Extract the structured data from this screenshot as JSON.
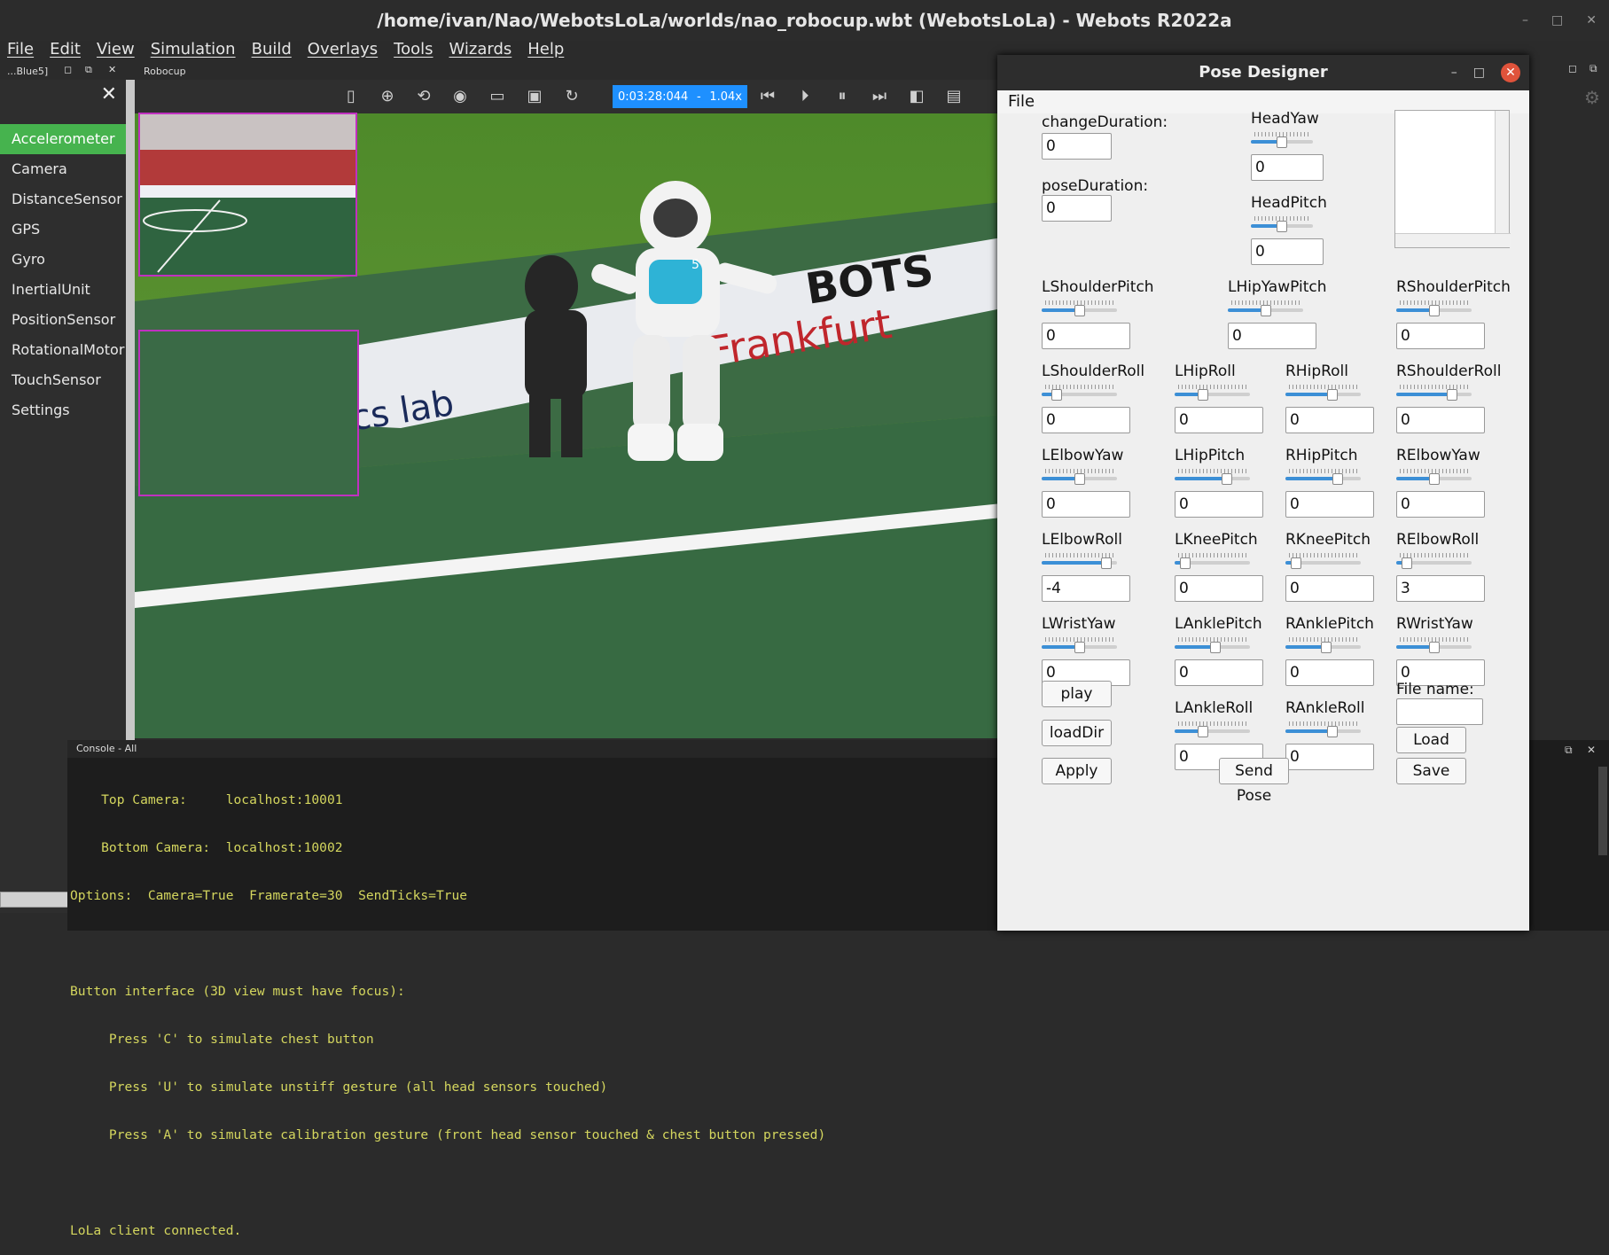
{
  "window": {
    "title": "/home/ivan/Nao/WebotsLoLa/worlds/nao_robocup.wbt (WebotsLoLa) - Webots R2022a",
    "controls": [
      "–",
      "□",
      "✕"
    ]
  },
  "menu": [
    "File",
    "Edit",
    "View",
    "Simulation",
    "Build",
    "Overlays",
    "Tools",
    "Wizards",
    "Help"
  ],
  "subtabs": {
    "left": "...Blue5]",
    "right": "Robocup"
  },
  "sidebar": {
    "items": [
      "Accelerometer",
      "Camera",
      "DistanceSensor",
      "GPS",
      "Gyro",
      "InertialUnit",
      "PositionSensor",
      "RotationalMotor",
      "TouchSensor",
      "Settings"
    ],
    "active": "Accelerometer"
  },
  "toolbar": {
    "time": "0:03:28:044",
    "separator": "-",
    "speed": "1.04x"
  },
  "scene": {
    "banner_text_1": "BOTS",
    "banner_text_2": "Frankfurt",
    "banner_text_3": "tics lab",
    "jersey_number": "5"
  },
  "console": {
    "title": "Console - All",
    "lines": [
      "    Top Camera:     localhost:10001",
      "    Bottom Camera:  localhost:10002",
      "Options:  Camera=True  Framerate=30  SendTicks=True",
      "",
      "Button interface (3D view must have focus):",
      "     Press 'C' to simulate chest button",
      "     Press 'U' to simulate unstiff gesture (all head sensors touched)",
      "     Press 'A' to simulate calibration gesture (front head sensor touched & chest button pressed)",
      "",
      "LoLa client connected."
    ]
  },
  "pose_designer": {
    "title": "Pose Designer",
    "menu_file": "File",
    "change_duration": {
      "label": "changeDuration:",
      "value": "0"
    },
    "pose_duration": {
      "label": "poseDuration:",
      "value": "0"
    },
    "joints": [
      {
        "name": "HeadYaw",
        "value": "0",
        "level": 0.5
      },
      {
        "name": "HeadPitch",
        "value": "0",
        "level": 0.5
      },
      {
        "name": "LShoulderPitch",
        "value": "0",
        "level": 0.5
      },
      {
        "name": "LHipYawPitch",
        "value": "0",
        "level": 0.5
      },
      {
        "name": "RShoulderPitch",
        "value": "0",
        "level": 0.5
      },
      {
        "name": "LShoulderRoll",
        "value": "0",
        "level": 0.15
      },
      {
        "name": "LHipRoll",
        "value": "0",
        "level": 0.35
      },
      {
        "name": "RHipRoll",
        "value": "0",
        "level": 0.65
      },
      {
        "name": "RShoulderRoll",
        "value": "0",
        "level": 0.78
      },
      {
        "name": "LElbowYaw",
        "value": "0",
        "level": 0.5
      },
      {
        "name": "LHipPitch",
        "value": "0",
        "level": 0.72
      },
      {
        "name": "RHipPitch",
        "value": "0",
        "level": 0.72
      },
      {
        "name": "RElbowYaw",
        "value": "0",
        "level": 0.5
      },
      {
        "name": "LElbowRoll",
        "value": "-4",
        "level": 0.92
      },
      {
        "name": "LKneePitch",
        "value": "0",
        "level": 0.08
      },
      {
        "name": "RKneePitch",
        "value": "0",
        "level": 0.08
      },
      {
        "name": "RElbowRoll",
        "value": "3",
        "level": 0.08
      },
      {
        "name": "LWristYaw",
        "value": "0",
        "level": 0.5
      },
      {
        "name": "LAnklePitch",
        "value": "0",
        "level": 0.55
      },
      {
        "name": "RAnklePitch",
        "value": "0",
        "level": 0.55
      },
      {
        "name": "RWristYaw",
        "value": "0",
        "level": 0.5
      },
      {
        "name": "LAnkleRoll",
        "value": "0",
        "level": 0.35
      },
      {
        "name": "RAnkleRoll",
        "value": "0",
        "level": 0.65
      }
    ],
    "buttons": {
      "play": "play",
      "loaddir": "loadDir",
      "apply": "Apply",
      "send_pose": "Send Pose",
      "load": "Load",
      "save": "Save"
    },
    "file_name": {
      "label": "File name:",
      "value": ""
    }
  }
}
